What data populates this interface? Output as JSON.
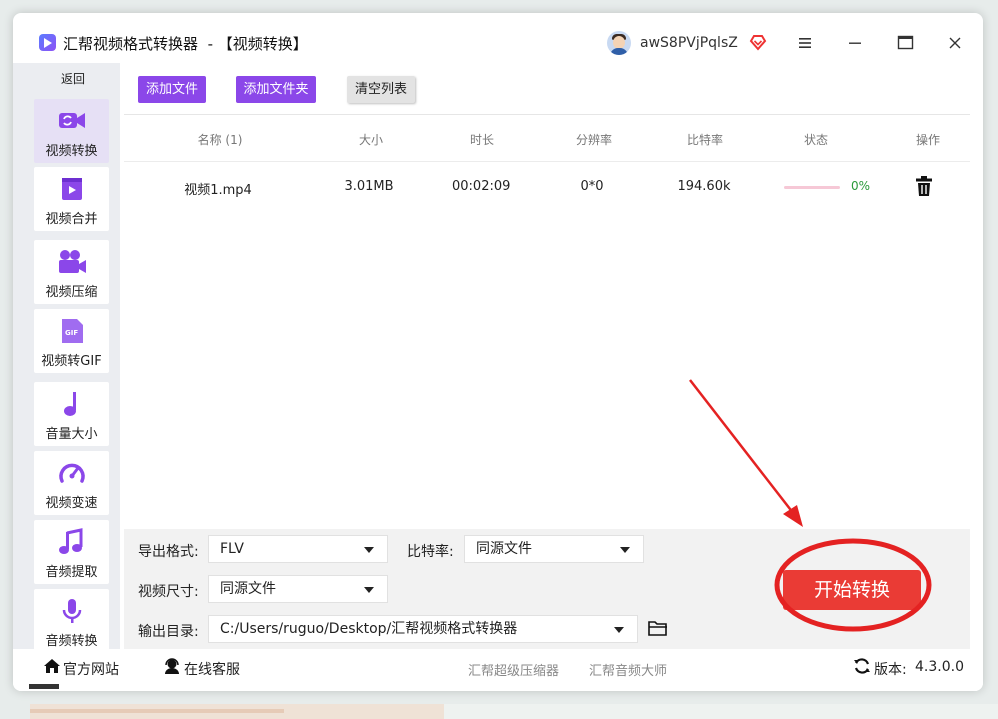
{
  "window": {
    "app_title": "汇帮视频格式转换器",
    "mode_title": "- 【视频转换】",
    "username": "awS8PVjPqlsZ"
  },
  "sidebar": {
    "back": "返回",
    "items": [
      {
        "label": "视频转换",
        "icon": "video-convert-icon",
        "active": true
      },
      {
        "label": "视频合并",
        "icon": "video-merge-icon"
      },
      {
        "label": "视频压缩",
        "icon": "video-compress-icon"
      },
      {
        "label": "视频转GIF",
        "icon": "gif-icon"
      },
      {
        "label": "音量大小",
        "icon": "music-note-icon"
      },
      {
        "label": "视频变速",
        "icon": "speedometer-icon"
      },
      {
        "label": "音频提取",
        "icon": "music-extract-icon"
      },
      {
        "label": "音频转换",
        "icon": "microphone-icon"
      }
    ]
  },
  "toolbar": {
    "add_file": "添加文件",
    "add_folder": "添加文件夹",
    "clear_list": "清空列表"
  },
  "table": {
    "headers": [
      "名称 (1)",
      "大小",
      "时长",
      "分辨率",
      "比特率",
      "状态",
      "操作"
    ],
    "rows": [
      {
        "name": "视频1.mp4",
        "size": "3.01MB",
        "duration": "00:02:09",
        "resolution": "0*0",
        "bitrate": "194.60k",
        "progress_percent": 0,
        "status": "0%"
      }
    ]
  },
  "settings": {
    "format_label": "导出格式:",
    "format_value": "FLV",
    "bitrate_label": "比特率:",
    "bitrate_value": "同源文件",
    "size_label": "视频尺寸:",
    "size_value": "同源文件",
    "output_label": "输出目录:",
    "output_value": "C:/Users/ruguo/Desktop/汇帮视频格式转换器"
  },
  "start_button": "开始转换",
  "footer": {
    "website": "官方网站",
    "support": "在线客服",
    "link1": "汇帮超级压缩器",
    "link2": "汇帮音频大师",
    "version_label": "版本:",
    "version_value": "4.3.0.0"
  },
  "colors": {
    "accent": "#8b47e9",
    "start": "#ea3b35",
    "annotation": "#e42222",
    "progress_text": "#2a9a3a"
  }
}
